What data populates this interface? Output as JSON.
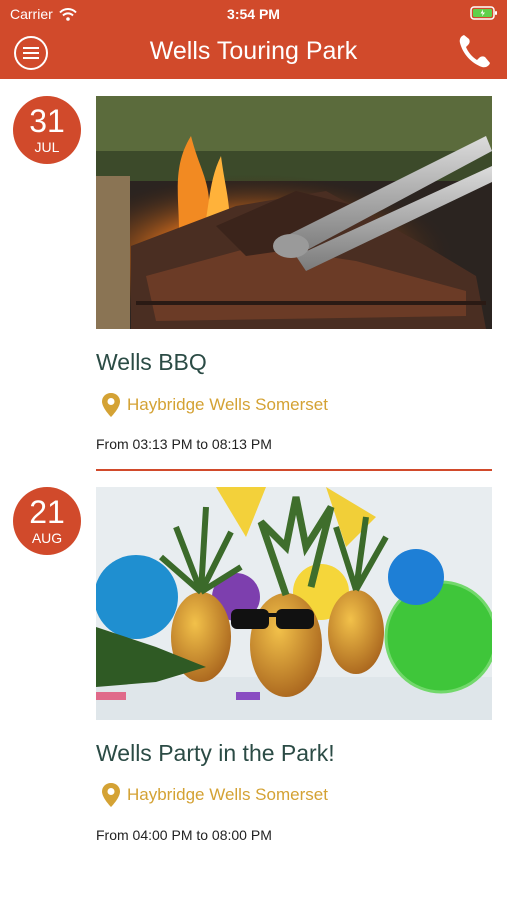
{
  "status_bar": {
    "carrier": "Carrier",
    "time": "3:54 PM"
  },
  "header": {
    "title": "Wells Touring Park",
    "menu_icon": "hamburger-menu-icon",
    "phone_icon": "phone-icon"
  },
  "colors": {
    "accent": "#d14a2b",
    "title_text": "#2b4b45",
    "location_text": "#d4a234"
  },
  "events": [
    {
      "day": "31",
      "month": "JUL",
      "title": "Wells BBQ",
      "location": "Haybridge Wells Somerset",
      "time": "From 03:13 PM to 08:13 PM",
      "image": "bbq-grill-photo"
    },
    {
      "day": "21",
      "month": "AUG",
      "title": "Wells Party in the Park!",
      "location": "Haybridge Wells Somerset",
      "time": "From 04:00 PM to 08:00 PM",
      "image": "party-pineapples-photo"
    }
  ]
}
